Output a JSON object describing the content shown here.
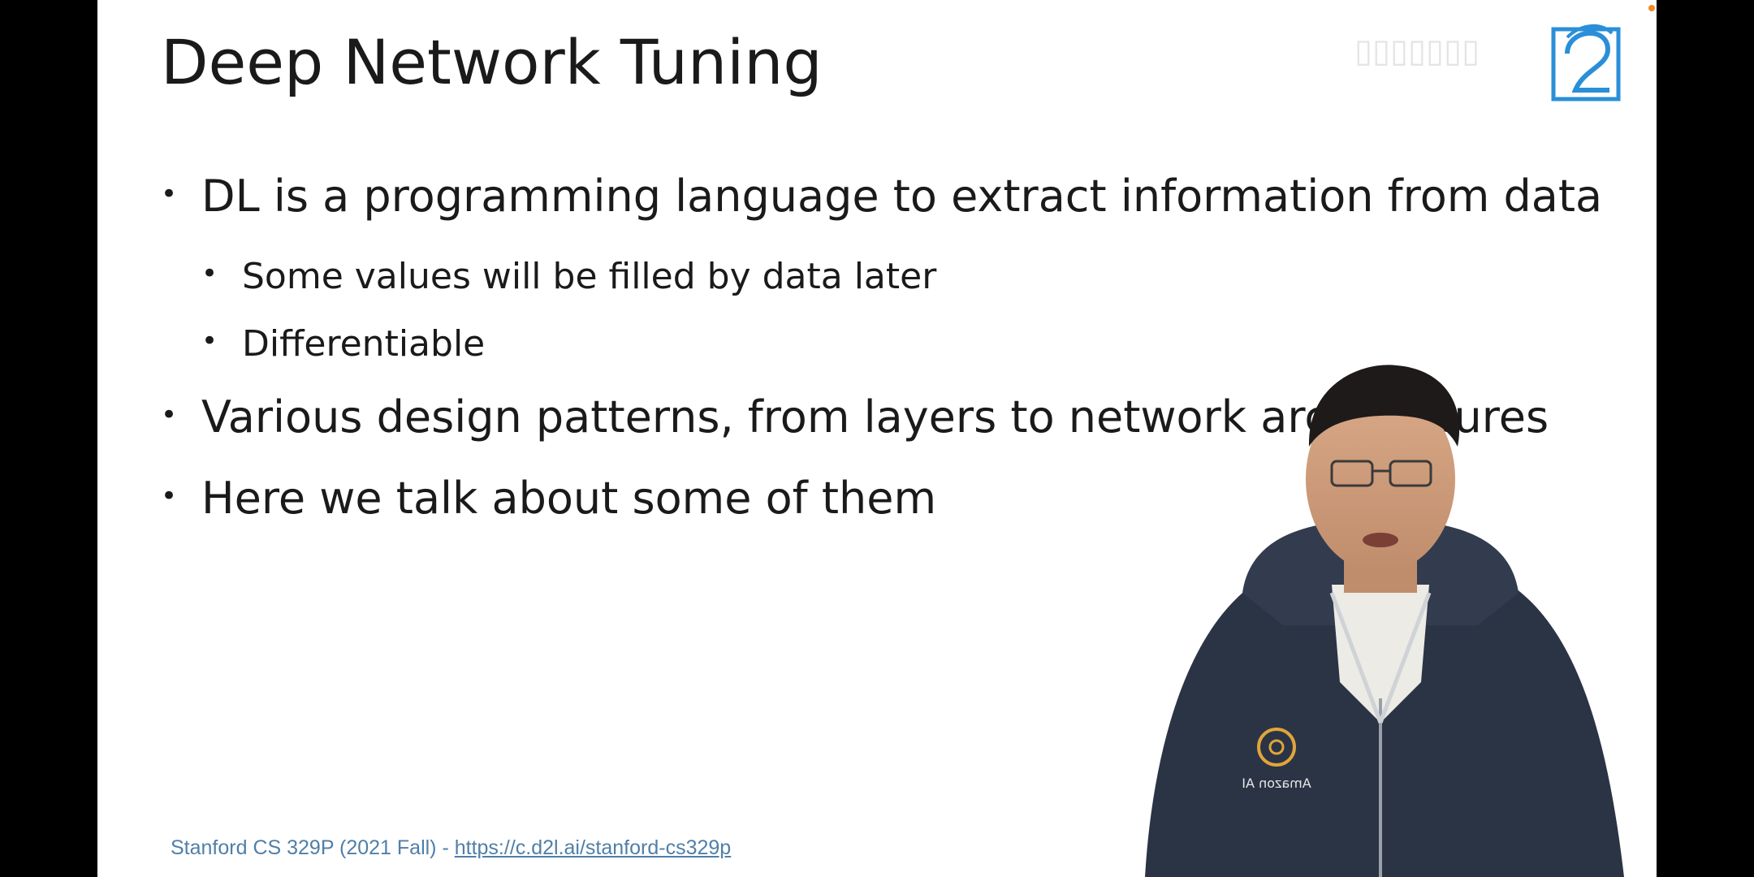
{
  "slide": {
    "title": "Deep Network Tuning",
    "bullets": [
      {
        "text": "DL is a programming language to extract information from data",
        "level": 1
      },
      {
        "text": "Some values will be filled by data later",
        "level": 2
      },
      {
        "text": "Differentiable",
        "level": 2
      },
      {
        "text": "Various design patterns, from layers to network architectures",
        "level": 1
      },
      {
        "text": "Here we talk about some of them",
        "level": 1
      }
    ],
    "footer": {
      "prefix": "Stanford CS 329P (2021 Fall) - ",
      "link_text": "https://c.d2l.ai/stanford-cs329p"
    },
    "presenter_shirt_logo": "Amazon AI"
  },
  "colors": {
    "footer": "#4f7fa8",
    "logo": "#2a8fd8",
    "hoodie": "#2b3445"
  },
  "icons": {
    "logo": "d2l-logo-icon"
  }
}
